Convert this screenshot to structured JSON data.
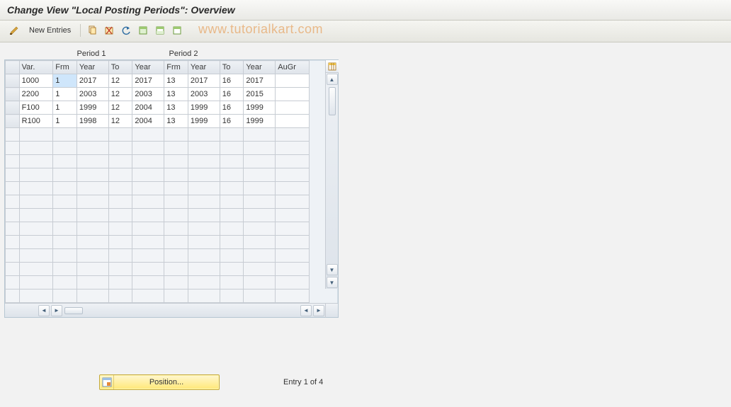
{
  "header": {
    "title": "Change View \"Local Posting Periods\": Overview"
  },
  "watermark": "www.tutorialkart.com",
  "toolbar": {
    "new_entries_label": "New Entries"
  },
  "group_headers": {
    "period1": "Period 1",
    "period2": "Period 2"
  },
  "columns": {
    "var": "Var.",
    "frm1": "Frm",
    "year1": "Year",
    "to1": "To",
    "year2": "Year",
    "frm2": "Frm",
    "year3": "Year",
    "to2": "To",
    "year4": "Year",
    "augr": "AuGr"
  },
  "chart_data": {
    "type": "table",
    "columns": [
      "Var.",
      "Frm",
      "Year",
      "To",
      "Year",
      "Frm",
      "Year",
      "To",
      "Year",
      "AuGr"
    ],
    "rows": [
      {
        "var": "1000",
        "frm1": "1",
        "year1": "2017",
        "to1": "12",
        "year2": "2017",
        "frm2": "13",
        "year3": "2017",
        "to2": "16",
        "year4": "2017",
        "augr": ""
      },
      {
        "var": "2200",
        "frm1": "1",
        "year1": "2003",
        "to1": "12",
        "year2": "2003",
        "frm2": "13",
        "year3": "2003",
        "to2": "16",
        "year4": "2015",
        "augr": ""
      },
      {
        "var": "F100",
        "frm1": "1",
        "year1": "1999",
        "to1": "12",
        "year2": "2004",
        "frm2": "13",
        "year3": "1999",
        "to2": "16",
        "year4": "1999",
        "augr": ""
      },
      {
        "var": "R100",
        "frm1": "1",
        "year1": "1998",
        "to1": "12",
        "year2": "2004",
        "frm2": "13",
        "year3": "1999",
        "to2": "16",
        "year4": "1999",
        "augr": ""
      }
    ]
  },
  "footer": {
    "position_label": "Position...",
    "entry_text": "Entry 1 of 4"
  }
}
